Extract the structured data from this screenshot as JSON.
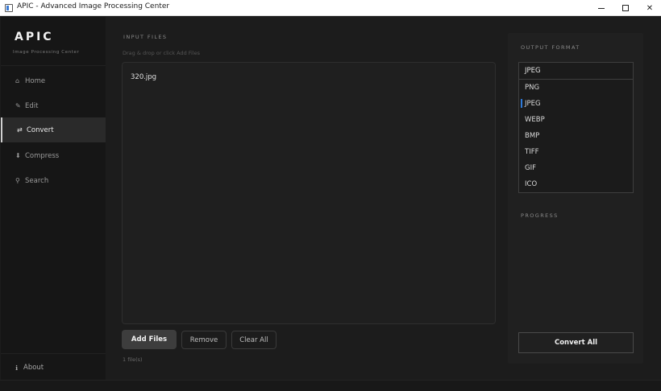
{
  "window": {
    "title": "APIC - Advanced Image Processing Center"
  },
  "sidebar": {
    "brand": "APIC",
    "subtitle": "Image Processing Center",
    "items": [
      {
        "icon": "home-icon",
        "glyph": "⌂",
        "label": "Home"
      },
      {
        "icon": "edit-icon",
        "glyph": "✎",
        "label": "Edit"
      },
      {
        "icon": "convert-icon",
        "glyph": "⇄",
        "label": "Convert"
      },
      {
        "icon": "compress-icon",
        "glyph": "⬇",
        "label": "Compress"
      },
      {
        "icon": "search-icon",
        "glyph": "⚲",
        "label": "Search"
      }
    ],
    "about": {
      "icon": "info-icon",
      "glyph": "ℹ",
      "label": "About"
    }
  },
  "input": {
    "section_label": "INPUT FILES",
    "hint": "Drag & drop or click Add Files",
    "files": [
      "320.jpg"
    ],
    "count_text": "1 file(s)"
  },
  "actions": {
    "add": "Add Files",
    "remove": "Remove",
    "clear": "Clear All"
  },
  "output": {
    "section_label": "OUTPUT FORMAT",
    "selected": "JPEG",
    "options": [
      "PNG",
      "JPEG",
      "WEBP",
      "BMP",
      "TIFF",
      "GIF",
      "ICO"
    ]
  },
  "progress": {
    "section_label": "PROGRESS"
  },
  "convert_button": "Convert All",
  "colors": {
    "background": "#1c1c1c",
    "sidebar": "#161616",
    "panel": "#202020",
    "accent": "#2f7ad8"
  }
}
